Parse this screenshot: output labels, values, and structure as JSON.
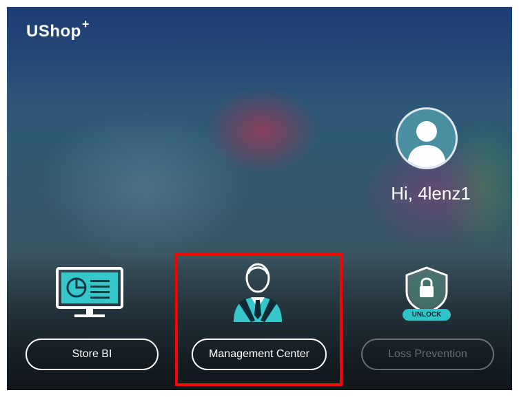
{
  "app": {
    "name": "UShop",
    "name_suffix": "+"
  },
  "user": {
    "greeting": "Hi, 4lenz1"
  },
  "modules": {
    "store_bi": {
      "label": "Store BI",
      "icon": "monitor-chart-icon"
    },
    "management_center": {
      "label": "Management Center",
      "icon": "manager-icon",
      "highlighted": true
    },
    "loss_prevention": {
      "label": "Loss Prevention",
      "icon": "lock-shield-icon",
      "badge": "UNLOCK",
      "enabled": false
    }
  },
  "colors": {
    "accent": "#30c3c8",
    "highlight": "#ff0000",
    "text": "#ffffff"
  }
}
